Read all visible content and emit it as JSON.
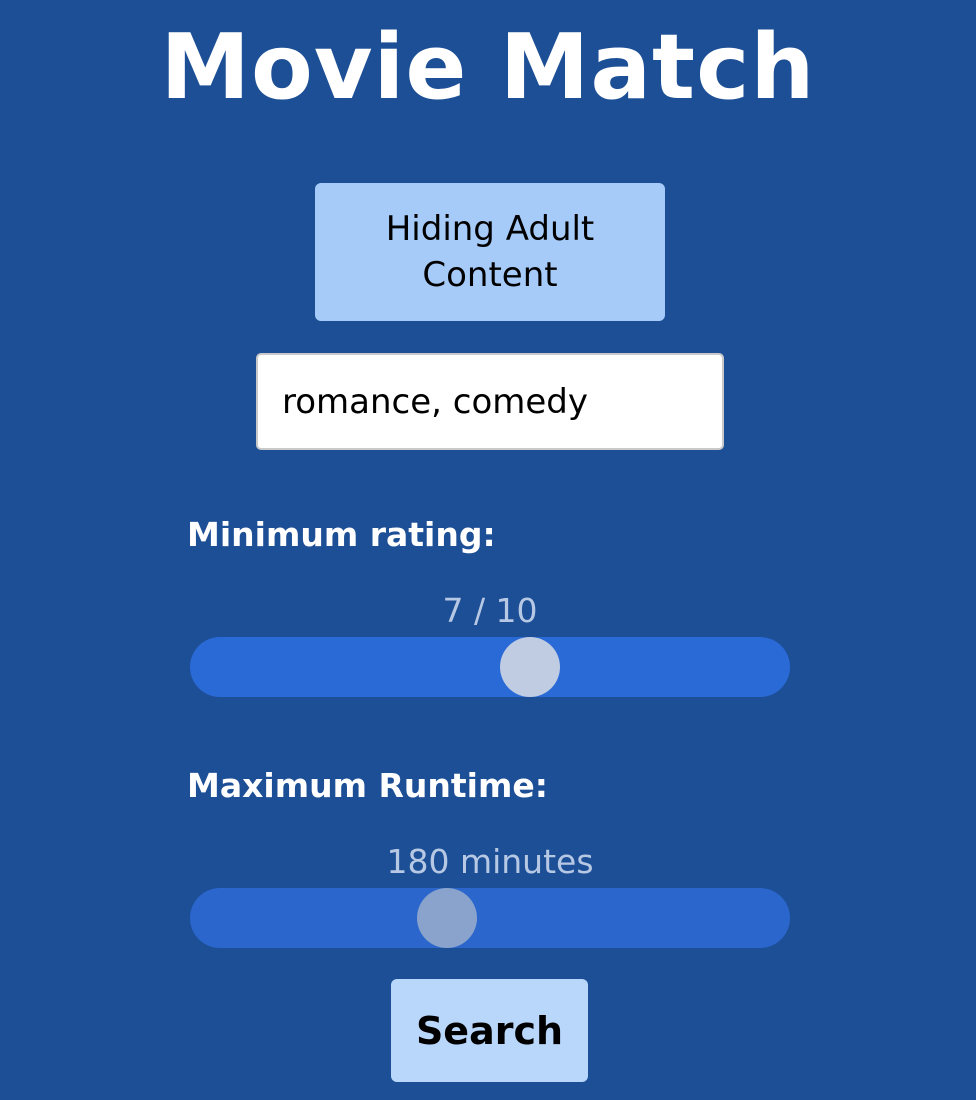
{
  "app": {
    "title": "Movie Match"
  },
  "adult_toggle": {
    "label": "Hiding Adult Content"
  },
  "genre_input": {
    "value": "romance, comedy",
    "placeholder": ""
  },
  "rating": {
    "label": "Minimum rating:",
    "readout": "7 / 10",
    "value": 7,
    "min": 0,
    "max": 10
  },
  "runtime": {
    "label": "Maximum Runtime:",
    "readout": "180 minutes",
    "value": 180
  },
  "search": {
    "label": "Search"
  },
  "colors": {
    "background": "#1d4f96",
    "toggle_bg": "#a6cbf9",
    "slider_track": "#2a6ad7",
    "search_bg": "#b9d7fb"
  }
}
